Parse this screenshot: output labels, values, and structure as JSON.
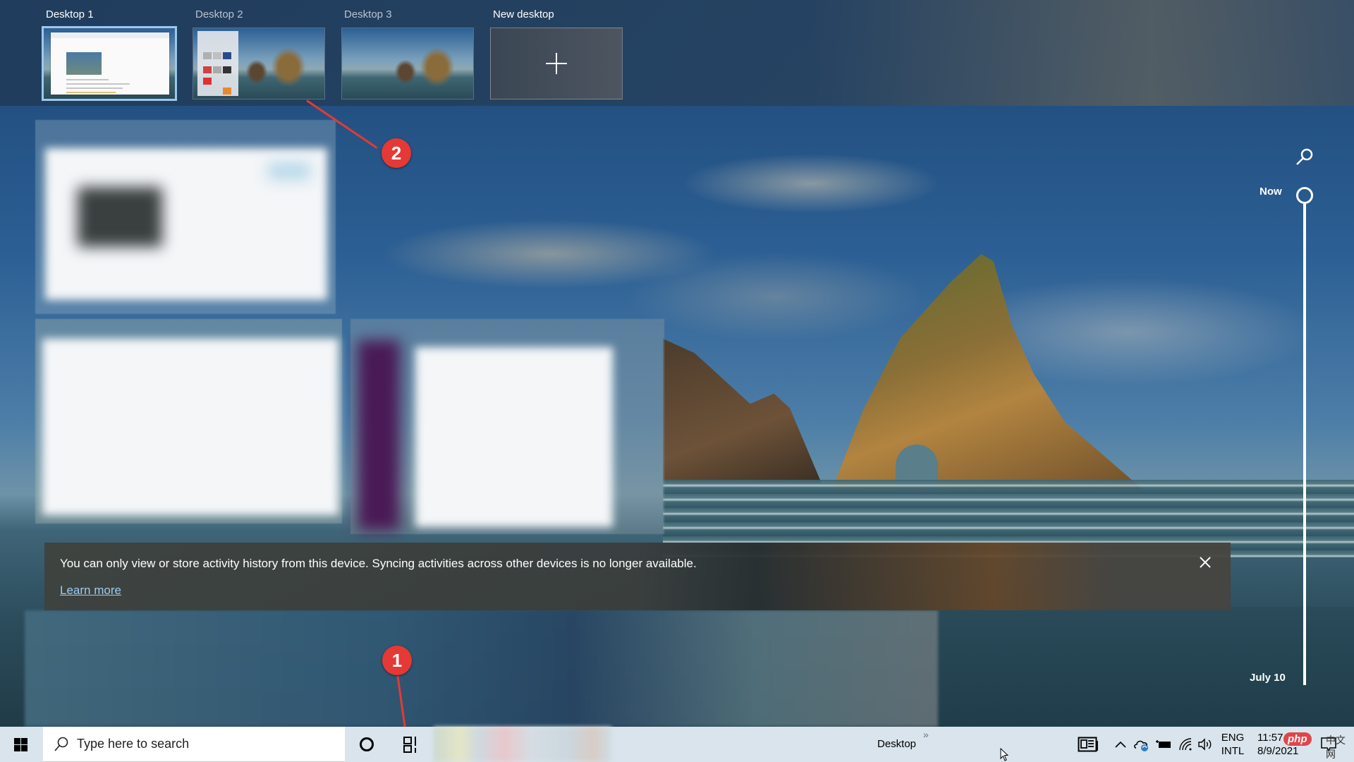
{
  "virtual_desktops": {
    "items": [
      {
        "label": "Desktop 1",
        "active": true
      },
      {
        "label": "Desktop 2",
        "active": false
      },
      {
        "label": "Desktop 3",
        "active": false
      }
    ],
    "new_desktop_label": "New desktop"
  },
  "callouts": [
    {
      "number": "1",
      "target": "task-view-button"
    },
    {
      "number": "2",
      "target": "desktop-2-thumbnail"
    }
  ],
  "timeline": {
    "now_label": "Now",
    "date_label": "July 10"
  },
  "notice": {
    "message": "You can only view or store activity history from this device. Syncing activities across other devices is no longer available.",
    "link_label": "Learn more"
  },
  "taskbar": {
    "search_placeholder": "Type here to search",
    "desktop_toolbar_label": "Desktop",
    "toolbar_overflow": "»",
    "language": {
      "line1": "ENG",
      "line2": "INTL"
    },
    "clock": {
      "time": "11:57 AM",
      "date": "8/9/2021"
    },
    "watermark": {
      "badge": "php",
      "text": "中文网"
    }
  },
  "icons": {
    "start": "windows-logo-icon",
    "search": "search-icon",
    "cortana": "cortana-icon",
    "task_view": "task-view-icon",
    "news": "news-and-interests-icon",
    "tray_overflow": "chevron-up-icon",
    "onedrive": "onedrive-sync-icon",
    "battery": "battery-charging-icon",
    "wifi": "wifi-icon",
    "volume": "volume-icon",
    "action_center": "action-center-icon"
  },
  "colors": {
    "accent_selected_border": "#9cc8ee",
    "callout_red": "#e53935",
    "link_color": "#9ecbf0",
    "taskbar_bg": "#d9e4ec"
  }
}
